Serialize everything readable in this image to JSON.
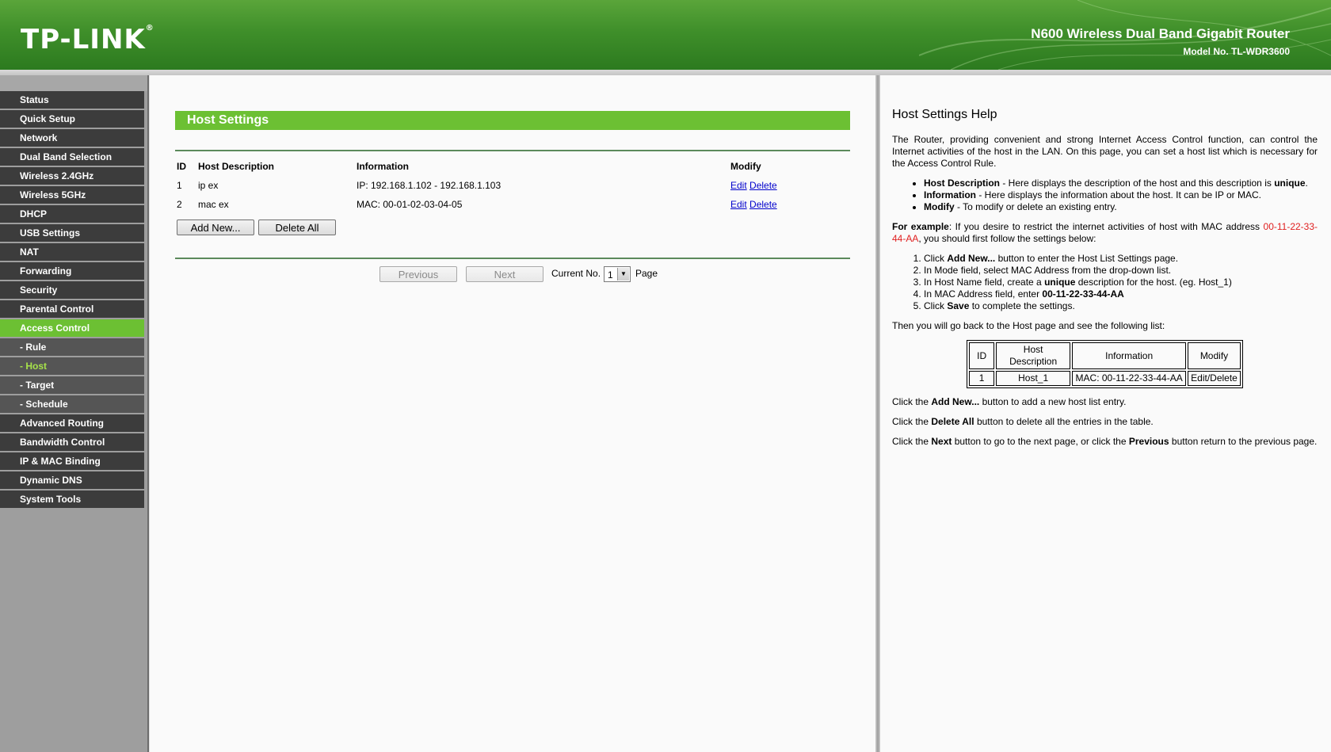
{
  "header": {
    "logo": "TP-LINK",
    "product": "N600 Wireless Dual Band Gigabit Router",
    "model": "Model No. TL-WDR3600"
  },
  "sidebar": {
    "items": [
      {
        "label": "Status"
      },
      {
        "label": "Quick Setup"
      },
      {
        "label": "Network"
      },
      {
        "label": "Dual Band Selection"
      },
      {
        "label": "Wireless 2.4GHz"
      },
      {
        "label": "Wireless 5GHz"
      },
      {
        "label": "DHCP"
      },
      {
        "label": "USB Settings"
      },
      {
        "label": "NAT"
      },
      {
        "label": "Forwarding"
      },
      {
        "label": "Security"
      },
      {
        "label": "Parental Control"
      },
      {
        "label": "Access Control"
      },
      {
        "label": "- Rule"
      },
      {
        "label": "- Host"
      },
      {
        "label": "- Target"
      },
      {
        "label": "- Schedule"
      },
      {
        "label": "Advanced Routing"
      },
      {
        "label": "Bandwidth Control"
      },
      {
        "label": "IP & MAC Binding"
      },
      {
        "label": "Dynamic DNS"
      },
      {
        "label": "System Tools"
      }
    ]
  },
  "main": {
    "title": "Host Settings",
    "columns": {
      "id": "ID",
      "desc": "Host Description",
      "info": "Information",
      "modify": "Modify"
    },
    "rows": [
      {
        "id": "1",
        "desc": "ip ex",
        "info": "IP: 192.168.1.102 - 192.168.1.103",
        "edit": "Edit",
        "delete": "Delete"
      },
      {
        "id": "2",
        "desc": "mac ex",
        "info": "MAC: 00-01-02-03-04-05",
        "edit": "Edit",
        "delete": "Delete"
      }
    ],
    "add_new": "Add New...",
    "delete_all": "Delete All",
    "previous": "Previous",
    "next": "Next",
    "current_no": "Current No.",
    "page_value": "1",
    "page_label": "Page"
  },
  "help": {
    "title": "Host Settings Help",
    "intro": "The Router, providing convenient and strong Internet Access Control function, can control the Internet activities of the host in the LAN. On this page, you can set a host list which is necessary for the Access Control Rule.",
    "bullets": [
      {
        "term": "Host Description",
        "text": " - Here displays the description of the host and this description is ",
        "strong": "unique",
        "end": "."
      },
      {
        "term": "Information",
        "text": " - Here displays the information about the host. It can be IP or MAC.",
        "strong": "",
        "end": ""
      },
      {
        "term": "Modify",
        "text": " - To modify or delete an existing entry.",
        "strong": "",
        "end": ""
      }
    ],
    "example_label": "For example",
    "example_text1": ": If you desire to restrict the internet activities of host with MAC address ",
    "example_mac": "00-11-22-33-44-AA",
    "example_text2": ", you should first follow the settings below:",
    "steps": {
      "s1a": "Click ",
      "s1b": "Add New...",
      "s1c": " button to enter the Host List Settings page.",
      "s2": "In Mode field, select MAC Address from the drop-down list.",
      "s3a": "In Host Name field, create a ",
      "s3b": "unique",
      "s3c": " description for the host. (eg. Host_1)",
      "s4a": "In MAC Address field, enter ",
      "s4b": "00-11-22-33-44-AA",
      "s5a": "Click ",
      "s5b": "Save",
      "s5c": " to complete the settings."
    },
    "then_text": "Then you will go back to the Host page and see the following list:",
    "example_table": {
      "headers": [
        "ID",
        "Host Description",
        "Information",
        "Modify"
      ],
      "row": [
        "1",
        "Host_1",
        "MAC: 00-11-22-33-44-AA",
        "Edit/Delete"
      ]
    },
    "p_add_a": "Click the ",
    "p_add_b": "Add New...",
    "p_add_c": " button to add a new host list entry.",
    "p_del_a": "Click the ",
    "p_del_b": "Delete All",
    "p_del_c": " button to delete all the entries in the table.",
    "p_nav_a": "Click the ",
    "p_nav_b": "Next",
    "p_nav_c": " button to go to the next page, or click the ",
    "p_nav_d": "Previous",
    "p_nav_e": " button return to the previous page."
  }
}
